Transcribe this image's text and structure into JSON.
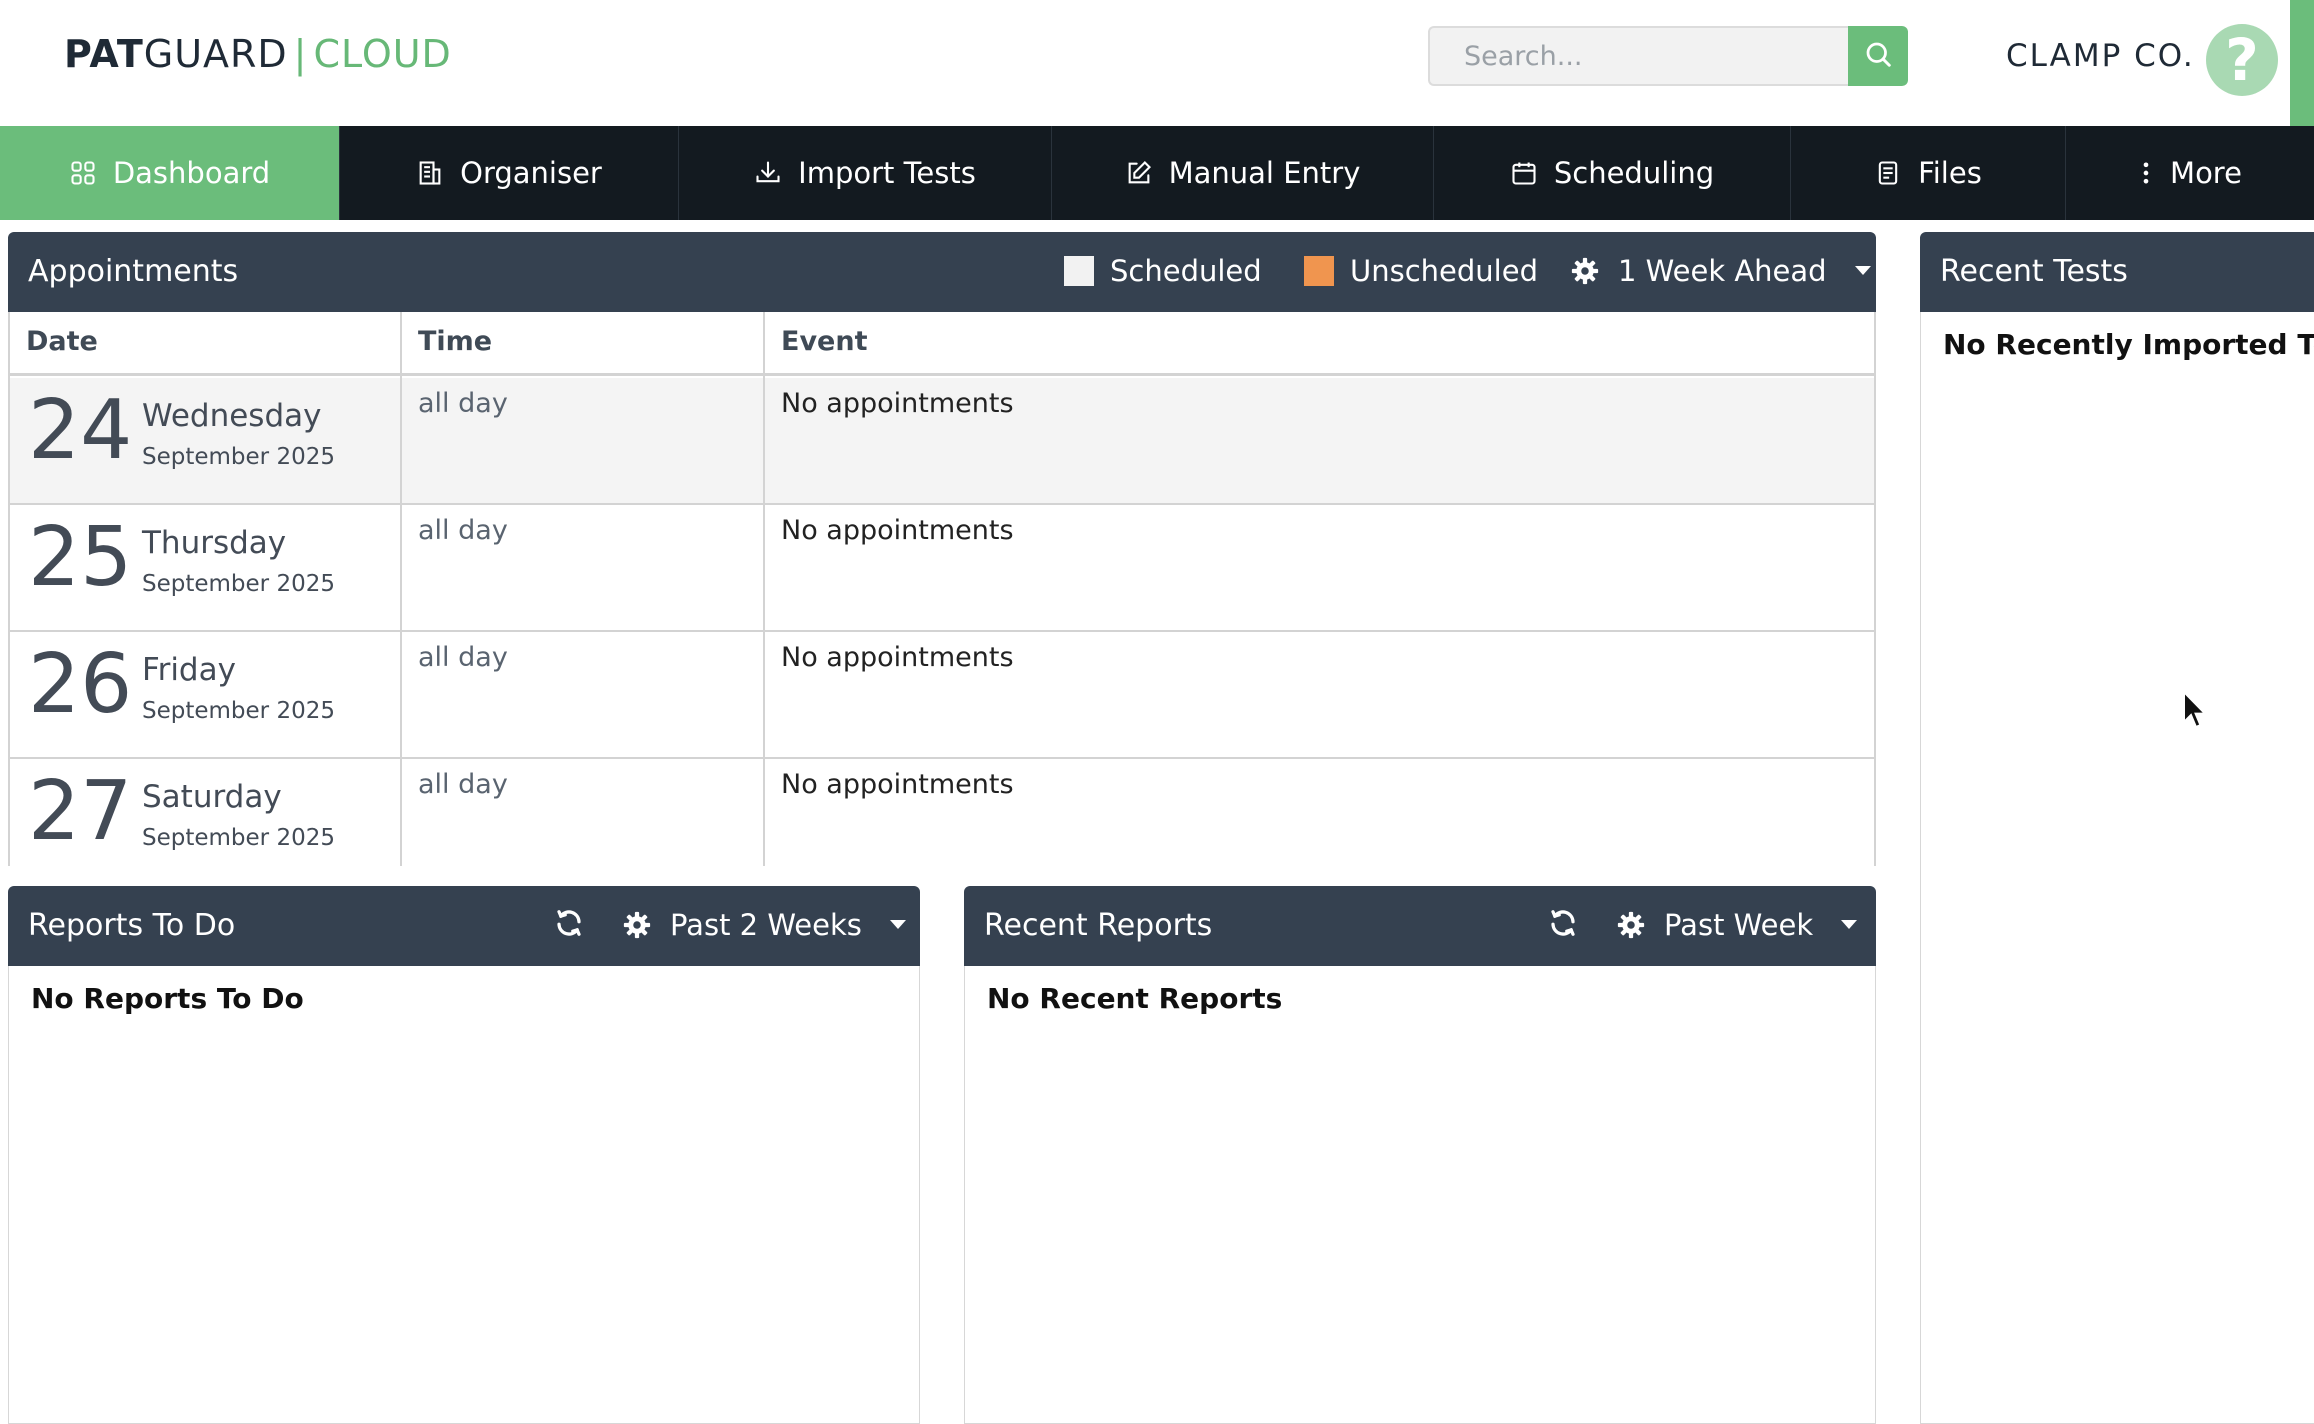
{
  "header": {
    "logo": {
      "pat": "PAT",
      "guard": "GUARD",
      "separator": "|",
      "cloud": "CLOUD"
    },
    "search": {
      "placeholder": "Search..."
    },
    "company": "CLAMP CO.",
    "help_label": "?"
  },
  "nav": {
    "items": [
      {
        "label": "Dashboard",
        "icon": "grid-icon"
      },
      {
        "label": "Organiser",
        "icon": "building-icon"
      },
      {
        "label": "Import Tests",
        "icon": "download-icon"
      },
      {
        "label": "Manual Entry",
        "icon": "edit-icon"
      },
      {
        "label": "Scheduling",
        "icon": "calendar-icon"
      },
      {
        "label": "Files",
        "icon": "document-icon"
      },
      {
        "label": "More",
        "icon": "more-vertical-icon"
      }
    ],
    "active": "Dashboard"
  },
  "appointments": {
    "title": "Appointments",
    "legend": {
      "scheduled": "Scheduled",
      "unscheduled": "Unscheduled"
    },
    "range": "1 Week Ahead",
    "columns": {
      "date": "Date",
      "time": "Time",
      "event": "Event"
    },
    "rows": [
      {
        "day": "24",
        "weekday": "Wednesday",
        "month_year": "September 2025",
        "time": "all day",
        "event": "No appointments"
      },
      {
        "day": "25",
        "weekday": "Thursday",
        "month_year": "September 2025",
        "time": "all day",
        "event": "No appointments"
      },
      {
        "day": "26",
        "weekday": "Friday",
        "month_year": "September 2025",
        "time": "all day",
        "event": "No appointments"
      },
      {
        "day": "27",
        "weekday": "Saturday",
        "month_year": "September 2025",
        "time": "all day",
        "event": "No appointments"
      }
    ]
  },
  "recent_tests": {
    "title": "Recent Tests",
    "empty": "No Recently Imported Tests"
  },
  "reports_todo": {
    "title": "Reports To Do",
    "range": "Past 2 Weeks",
    "empty": "No Reports To Do"
  },
  "recent_reports": {
    "title": "Recent Reports",
    "range": "Past Week",
    "empty": "No Recent Reports"
  },
  "colors": {
    "brand_green": "#6bbd7b",
    "nav_dark": "#131a20",
    "panel_header": "#354150",
    "scheduled_swatch": "#f2f2f2",
    "unscheduled_swatch": "#f0954f",
    "help_circle": "#a9d9b3"
  }
}
